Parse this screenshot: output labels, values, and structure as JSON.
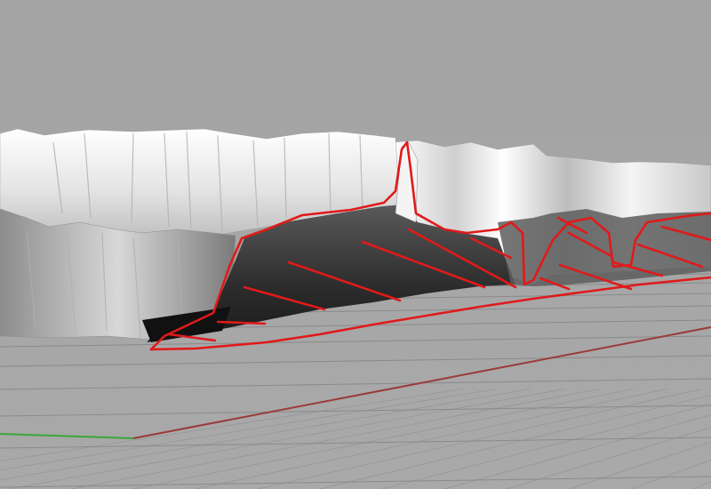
{
  "viewport": {
    "view": "perspective",
    "background_color": "#a5a5a5",
    "grid_line_color": "#8a8a8a",
    "x_axis_color": "#9b3a3a",
    "y_axis_color": "#3aa83a"
  },
  "model": {
    "kind": "terrain-mesh",
    "surface_light": "#f2f2f2",
    "surface_shadow": "#3a3a3a"
  },
  "sketch": {
    "stroke_color": "#e01a1a",
    "curve_count": 16
  }
}
